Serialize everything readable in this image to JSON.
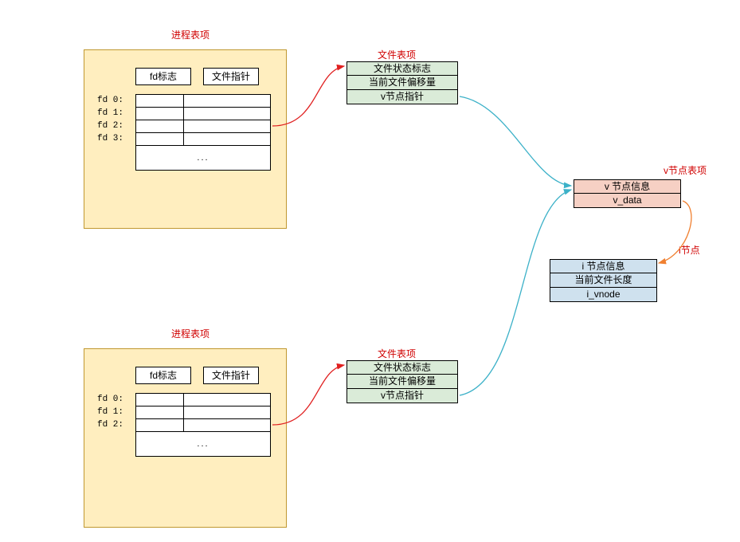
{
  "proc1": {
    "title": "进程表项",
    "col_fd": "fd标志",
    "col_ptr": "文件指针",
    "fd0": "fd 0:",
    "fd1": "fd 1:",
    "fd2": "fd 2:",
    "fd3": "fd 3:",
    "ellipsis": "..."
  },
  "proc2": {
    "title": "进程表项",
    "col_fd": "fd标志",
    "col_ptr": "文件指针",
    "fd0": "fd 0:",
    "fd1": "fd 1:",
    "fd2": "fd 2:",
    "ellipsis": "..."
  },
  "file1": {
    "title": "文件表项",
    "r1": "文件状态标志",
    "r2": "当前文件偏移量",
    "r3": "v节点指针"
  },
  "file2": {
    "title": "文件表项",
    "r1": "文件状态标志",
    "r2": "当前文件偏移量",
    "r3": "v节点指针"
  },
  "vnode": {
    "title": "v节点表项",
    "r1": "v 节点信息",
    "r2": "v_data"
  },
  "inode": {
    "title": "i节点",
    "r1": "i 节点信息",
    "r2": "当前文件长度",
    "r3": "i_vnode"
  }
}
